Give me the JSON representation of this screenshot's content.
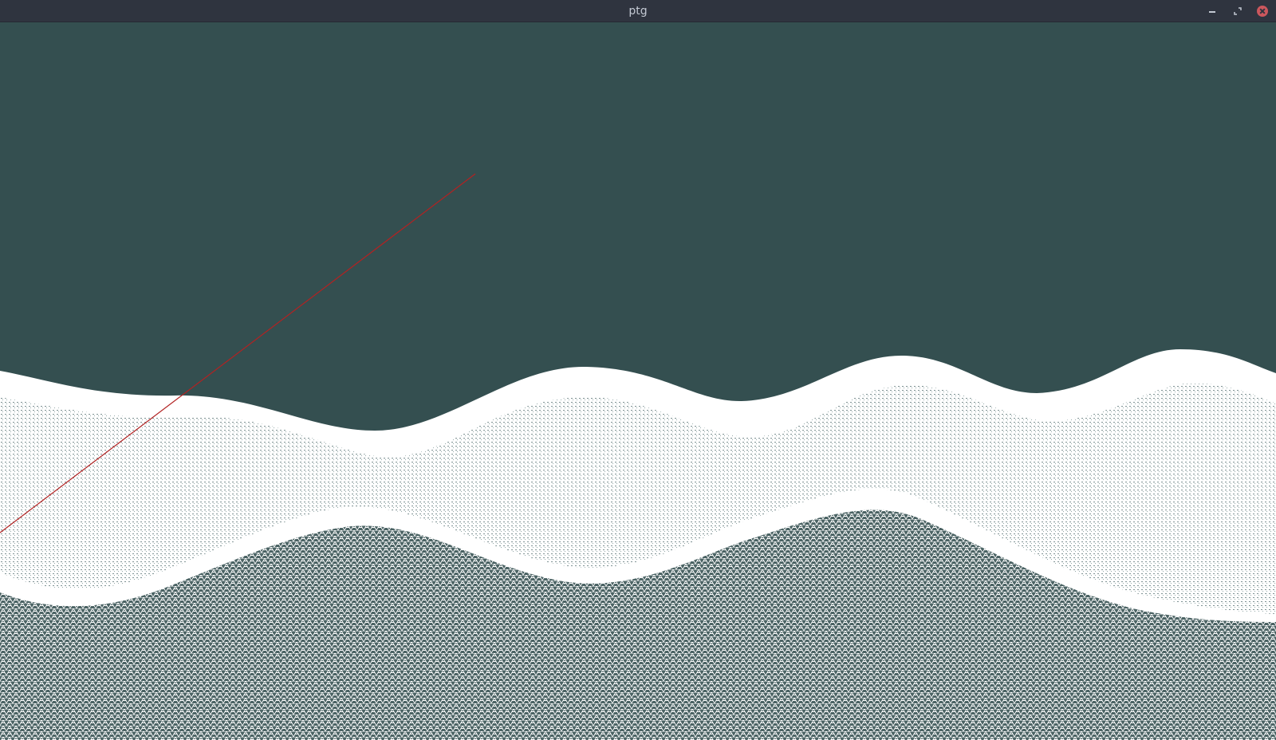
{
  "window": {
    "title": "ptg",
    "controls": {
      "minimize_icon": "minimize-icon",
      "maximize_icon": "restore-icon",
      "close_icon": "close-icon"
    }
  },
  "viewport": {
    "background_color": "#344f50",
    "mesh_color": "#ffffff",
    "ray_color": "#b22222"
  }
}
